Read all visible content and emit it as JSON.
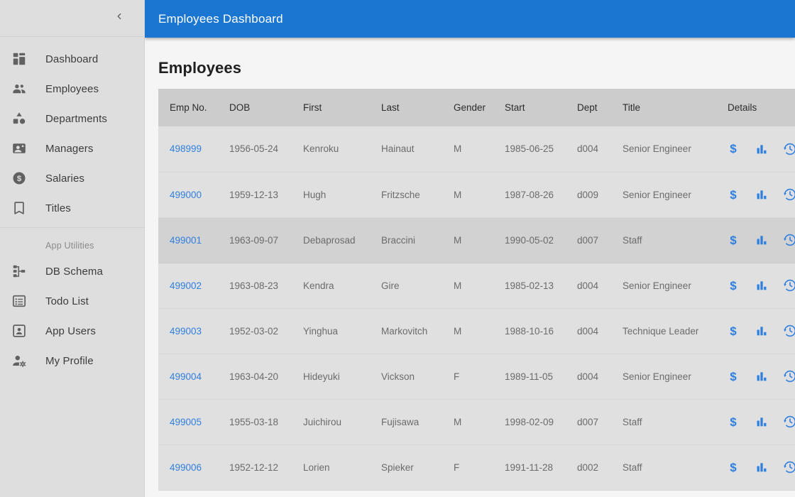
{
  "colors": {
    "brand_blue": "#1b76d2",
    "link_blue": "#2f7fe0",
    "sidebar_bg": "#dedede",
    "table_header_bg": "#cccccc",
    "row_bg": "#e0e0e0",
    "row_hover_bg": "#d2d2d2"
  },
  "header": {
    "title": "Employees Dashboard",
    "collapse_icon": "chevron-left-icon"
  },
  "sidebar": {
    "primary_items": [
      {
        "label": "Dashboard",
        "icon": "dashboard-grid-icon",
        "active": false
      },
      {
        "label": "Employees",
        "icon": "people-group-icon",
        "active": false
      },
      {
        "label": "Departments",
        "icon": "category-shapes-icon",
        "active": false
      },
      {
        "label": "Managers",
        "icon": "account-box-icon",
        "active": false
      },
      {
        "label": "Salaries",
        "icon": "dollar-circle-icon",
        "active": false
      },
      {
        "label": "Titles",
        "icon": "bookmark-icon",
        "active": false
      }
    ],
    "section_label": "App Utilities",
    "utility_items": [
      {
        "label": "DB Schema",
        "icon": "account-tree-icon",
        "active": false
      },
      {
        "label": "Todo List",
        "icon": "list-alt-icon",
        "active": true
      },
      {
        "label": "App Users",
        "icon": "contact-card-icon",
        "active": false
      },
      {
        "label": "My Profile",
        "icon": "manage-accounts-icon",
        "active": false
      }
    ]
  },
  "main": {
    "page_title": "Employees",
    "table": {
      "columns": [
        "Emp No.",
        "DOB",
        "First",
        "Last",
        "Gender",
        "Start",
        "Dept",
        "Title",
        "Details"
      ],
      "detail_icons": [
        "dollar-icon",
        "bar-chart-icon",
        "history-icon"
      ],
      "rows": [
        {
          "emp_no": "498999",
          "dob": "1956-05-24",
          "first": "Kenroku",
          "last": "Hainaut",
          "gender": "M",
          "start": "1985-06-25",
          "dept": "d004",
          "title": "Senior Engineer",
          "hovered": false
        },
        {
          "emp_no": "499000",
          "dob": "1959-12-13",
          "first": "Hugh",
          "last": "Fritzsche",
          "gender": "M",
          "start": "1987-08-26",
          "dept": "d009",
          "title": "Senior Engineer",
          "hovered": false
        },
        {
          "emp_no": "499001",
          "dob": "1963-09-07",
          "first": "Debaprosad",
          "last": "Braccini",
          "gender": "M",
          "start": "1990-05-02",
          "dept": "d007",
          "title": "Staff",
          "hovered": true
        },
        {
          "emp_no": "499002",
          "dob": "1963-08-23",
          "first": "Kendra",
          "last": "Gire",
          "gender": "M",
          "start": "1985-02-13",
          "dept": "d004",
          "title": "Senior Engineer",
          "hovered": false
        },
        {
          "emp_no": "499003",
          "dob": "1952-03-02",
          "first": "Yinghua",
          "last": "Markovitch",
          "gender": "M",
          "start": "1988-10-16",
          "dept": "d004",
          "title": "Technique Leader",
          "hovered": false
        },
        {
          "emp_no": "499004",
          "dob": "1963-04-20",
          "first": "Hideyuki",
          "last": "Vickson",
          "gender": "F",
          "start": "1989-11-05",
          "dept": "d004",
          "title": "Senior Engineer",
          "hovered": false
        },
        {
          "emp_no": "499005",
          "dob": "1955-03-18",
          "first": "Juichirou",
          "last": "Fujisawa",
          "gender": "M",
          "start": "1998-02-09",
          "dept": "d007",
          "title": "Staff",
          "hovered": false
        },
        {
          "emp_no": "499006",
          "dob": "1952-12-12",
          "first": "Lorien",
          "last": "Spieker",
          "gender": "F",
          "start": "1991-11-28",
          "dept": "d002",
          "title": "Staff",
          "hovered": false
        }
      ]
    }
  }
}
